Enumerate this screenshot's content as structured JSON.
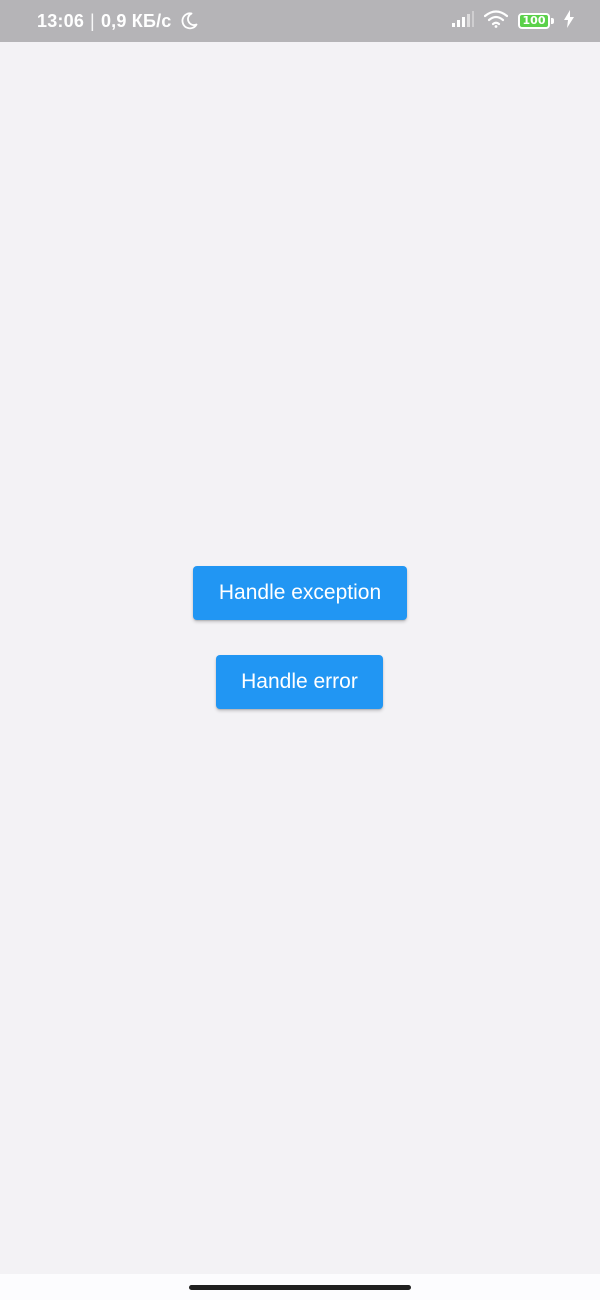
{
  "status_bar": {
    "time": "13:06",
    "separator": "|",
    "network_speed": "0,9 КБ/с",
    "battery_level": "100",
    "icons": [
      "moon-icon",
      "signal-icon",
      "wifi-icon",
      "battery-icon",
      "charging-icon"
    ]
  },
  "main": {
    "buttons": [
      {
        "label": "Handle exception"
      },
      {
        "label": "Handle error"
      }
    ]
  },
  "colors": {
    "background": "#f3f2f5",
    "status_bar": "#b5b4b7",
    "button": "#2196f3",
    "battery_fill": "#5bd14a"
  }
}
